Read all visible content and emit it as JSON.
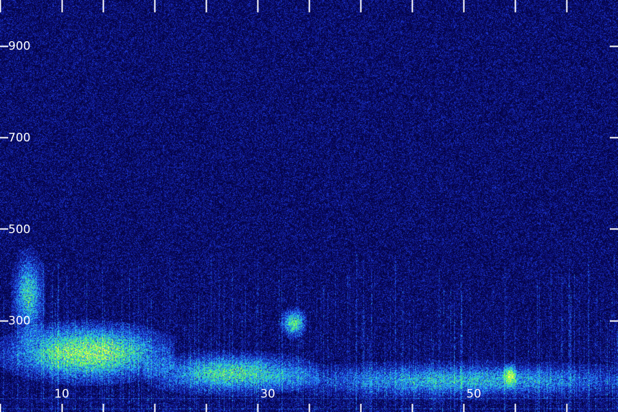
{
  "chart_data": {
    "type": "heatmap",
    "title": "",
    "xlabel": "",
    "ylabel": "",
    "xlim": [
      4,
      64
    ],
    "ylim": [
      100,
      1000
    ],
    "x_tick_labels": [
      "10",
      "30",
      "50"
    ],
    "x_tick_label_values": [
      10,
      30,
      50
    ],
    "x_tick_values": [
      4,
      10,
      14,
      19,
      24,
      29,
      34,
      39,
      44,
      49,
      54,
      59
    ],
    "y_tick_labels": [
      "900",
      "700",
      "500",
      "300"
    ],
    "y_tick_values": [
      900,
      700,
      500,
      300
    ],
    "colormap": [
      "#000020",
      "#0a0a6e",
      "#1e3cdc",
      "#28b4ff",
      "#32e6a0",
      "#78ff3c",
      "#ffff50"
    ],
    "background_level": 0.2,
    "energy_bands": [
      {
        "x_range": [
          6,
          19
        ],
        "y_range": [
          180,
          280
        ],
        "intensity": 0.8
      },
      {
        "x_range": [
          5.5,
          8
        ],
        "y_range": [
          280,
          430
        ],
        "intensity": 0.55
      },
      {
        "x_range": [
          20,
          33
        ],
        "y_range": [
          150,
          220
        ],
        "intensity": 0.6
      },
      {
        "x_range": [
          31.5,
          33.5
        ],
        "y_range": [
          270,
          320
        ],
        "intensity": 0.65
      },
      {
        "x_range": [
          34,
          64
        ],
        "y_range": [
          140,
          200
        ],
        "intensity": 0.45
      },
      {
        "x_range": [
          53,
          54
        ],
        "y_range": [
          160,
          200
        ],
        "intensity": 0.65
      }
    ]
  }
}
